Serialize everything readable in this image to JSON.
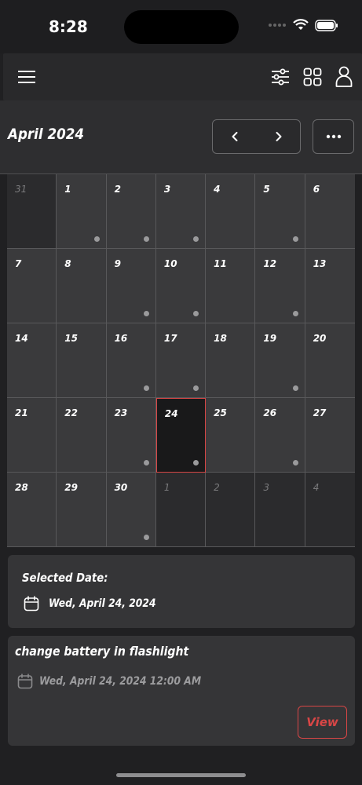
{
  "status_bar": {
    "time": "8:28"
  },
  "header": {
    "month_title": "April 2024",
    "prev_icon": "chevron-left-icon",
    "next_icon": "chevron-right-icon",
    "more_icon": "ellipsis-icon"
  },
  "app_bar": {
    "menu_icon": "hamburger-icon",
    "filter_icon": "sliders-icon",
    "grid_icon": "grid-icon",
    "profile_icon": "person-icon"
  },
  "calendar": {
    "days": [
      {
        "label": "31",
        "other": true,
        "dot": false
      },
      {
        "label": "1",
        "other": false,
        "dot": true
      },
      {
        "label": "2",
        "other": false,
        "dot": true
      },
      {
        "label": "3",
        "other": false,
        "dot": true
      },
      {
        "label": "4",
        "other": false,
        "dot": false
      },
      {
        "label": "5",
        "other": false,
        "dot": true
      },
      {
        "label": "6",
        "other": false,
        "dot": false
      },
      {
        "label": "7",
        "other": false,
        "dot": false
      },
      {
        "label": "8",
        "other": false,
        "dot": false
      },
      {
        "label": "9",
        "other": false,
        "dot": true
      },
      {
        "label": "10",
        "other": false,
        "dot": true
      },
      {
        "label": "11",
        "other": false,
        "dot": false
      },
      {
        "label": "12",
        "other": false,
        "dot": true
      },
      {
        "label": "13",
        "other": false,
        "dot": false
      },
      {
        "label": "14",
        "other": false,
        "dot": false
      },
      {
        "label": "15",
        "other": false,
        "dot": false
      },
      {
        "label": "16",
        "other": false,
        "dot": true
      },
      {
        "label": "17",
        "other": false,
        "dot": true
      },
      {
        "label": "18",
        "other": false,
        "dot": false
      },
      {
        "label": "19",
        "other": false,
        "dot": true
      },
      {
        "label": "20",
        "other": false,
        "dot": false
      },
      {
        "label": "21",
        "other": false,
        "dot": false
      },
      {
        "label": "22",
        "other": false,
        "dot": false
      },
      {
        "label": "23",
        "other": false,
        "dot": true
      },
      {
        "label": "24",
        "other": false,
        "dot": true,
        "selected": true
      },
      {
        "label": "25",
        "other": false,
        "dot": false
      },
      {
        "label": "26",
        "other": false,
        "dot": true
      },
      {
        "label": "27",
        "other": false,
        "dot": false
      },
      {
        "label": "28",
        "other": false,
        "dot": false
      },
      {
        "label": "29",
        "other": false,
        "dot": false
      },
      {
        "label": "30",
        "other": false,
        "dot": true
      },
      {
        "label": "1",
        "other": true,
        "dot": false
      },
      {
        "label": "2",
        "other": true,
        "dot": false
      },
      {
        "label": "3",
        "other": true,
        "dot": false
      },
      {
        "label": "4",
        "other": true,
        "dot": false
      }
    ]
  },
  "selected_card": {
    "label": "Selected Date:",
    "date": "Wed, April 24, 2024",
    "icon": "calendar-icon"
  },
  "event": {
    "title": "change battery in flashlight",
    "date": "Wed, April 24, 2024 12:00 AM",
    "icon": "calendar-icon",
    "view_label": "View"
  },
  "colors": {
    "accent": "#d84646",
    "background": "#202022",
    "card": "#353537"
  }
}
